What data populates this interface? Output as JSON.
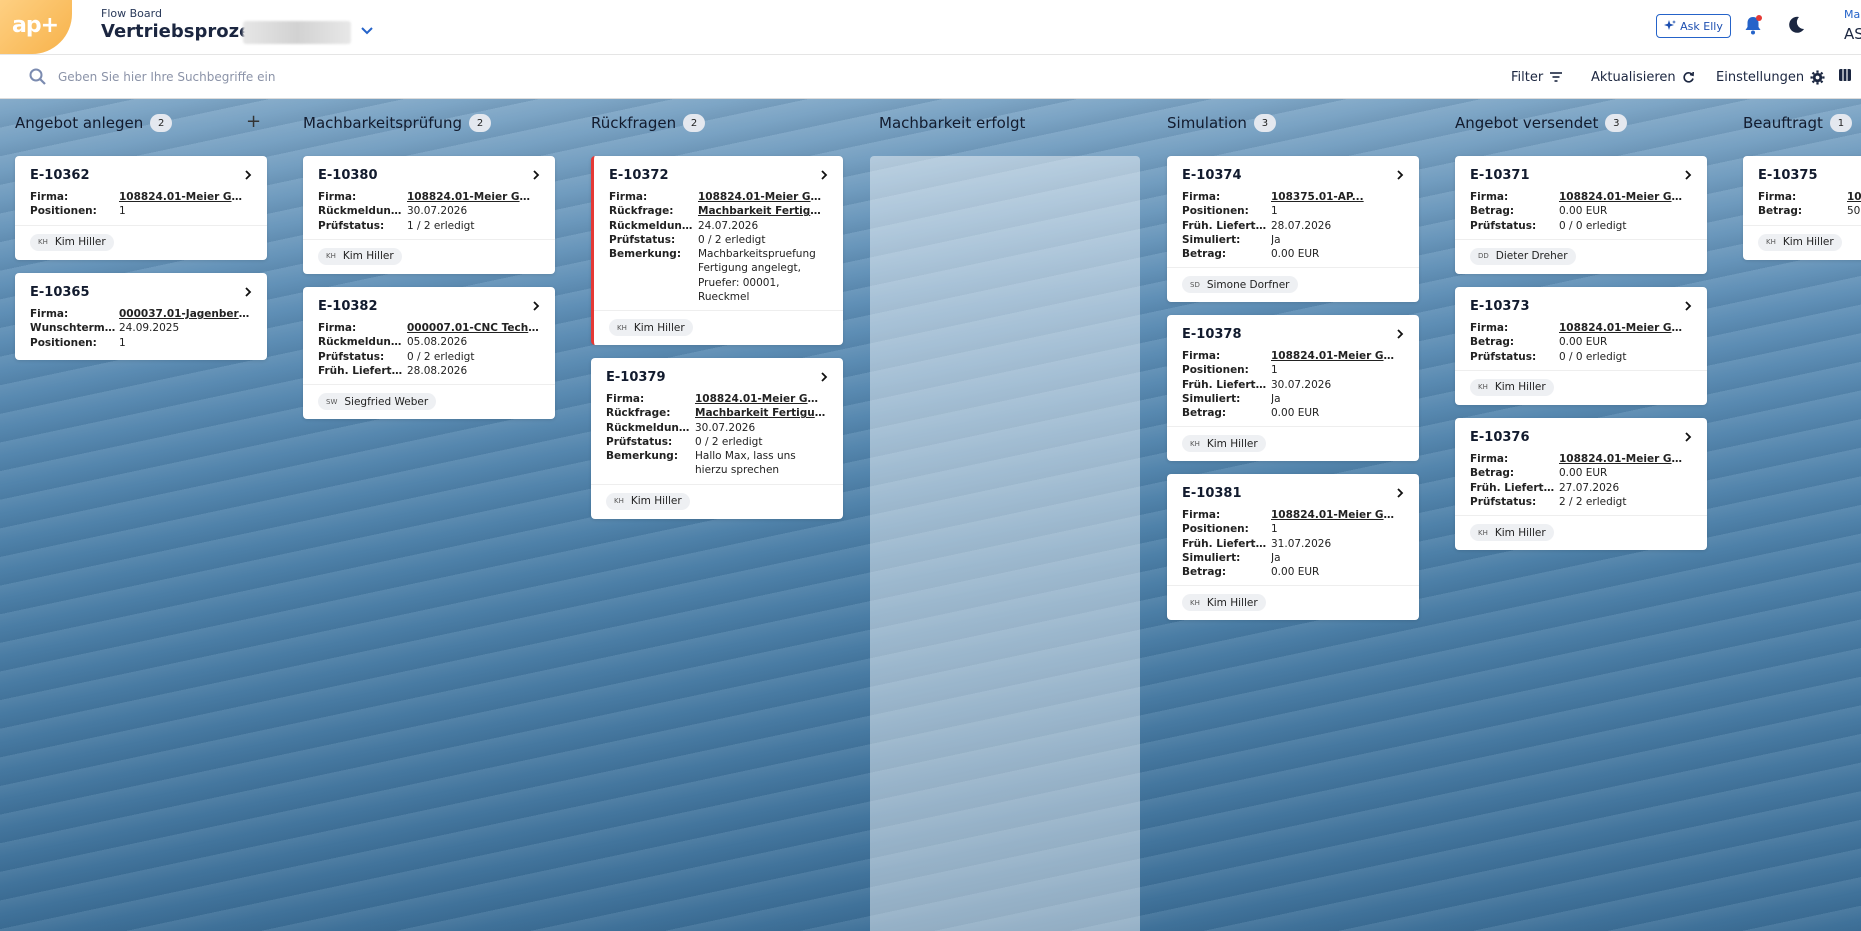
{
  "header": {
    "logo_text": "ap+",
    "subtitle": "Flow Board",
    "title": "Vertriebsprozess",
    "ask_label": "Ask Elly",
    "user_line1": "Ma",
    "user_line2": "AS"
  },
  "toolbar": {
    "search_placeholder": "Geben Sie hier Ihre Suchbegriffe ein",
    "filter_label": "Filter",
    "refresh_label": "Aktualisieren",
    "settings_label": "Einstellungen"
  },
  "columns": [
    {
      "title": "Angebot anlegen",
      "count": "2",
      "cards": [
        {
          "id": "E-10362",
          "rows": [
            [
              "Firma:",
              "108824.01-Meier GmbH"
            ],
            [
              "Positionen:",
              "1"
            ]
          ],
          "assignee_initials": "KH",
          "assignee": "Kim Hiller"
        },
        {
          "id": "E-10365",
          "rows": [
            [
              "Firma:",
              "000037.01-Jagenberg A..."
            ],
            [
              "Wunschtermin:",
              "24.09.2025"
            ],
            [
              "Positionen:",
              "1"
            ]
          ],
          "assignee_initials": "",
          "assignee": ""
        }
      ]
    },
    {
      "title": "Machbarkeitsprüfung",
      "count": "2",
      "cards": [
        {
          "id": "E-10380",
          "rows": [
            [
              "Firma:",
              "108824.01-Meier GmbH"
            ],
            [
              "Rückmeldung b...",
              "30.07.2026"
            ],
            [
              "Prüfstatus:",
              "1 / 2 erledigt"
            ]
          ],
          "assignee_initials": "KH",
          "assignee": "Kim Hiller"
        },
        {
          "id": "E-10382",
          "rows": [
            [
              "Firma:",
              "000007.01-CNC Technik"
            ],
            [
              "Rückmeldung b...",
              "05.08.2026"
            ],
            [
              "Prüfstatus:",
              "0 / 2 erledigt"
            ],
            [
              "Früh. Lieferter...",
              "28.08.2026"
            ]
          ],
          "assignee_initials": "SW",
          "assignee": "Siegfried Weber"
        }
      ]
    },
    {
      "title": "Rückfragen",
      "count": "2",
      "cards": [
        {
          "id": "E-10372",
          "rows": [
            [
              "Firma:",
              "108824.01-Meier GmbH"
            ],
            [
              "Rückfrage:",
              "Machbarkeit Fertigung: ..."
            ],
            [
              "Rückmeldung b...",
              "24.07.2026"
            ],
            [
              "Prüfstatus:",
              "0 / 2 erledigt"
            ],
            [
              "Bemerkung:",
              "Machbarkeitspruefung Fertigung angelegt, Pruefer: 00001, Rueckmel"
            ]
          ],
          "assignee_initials": "KH",
          "assignee": "Kim Hiller"
        },
        {
          "id": "E-10379",
          "rows": [
            [
              "Firma:",
              "108824.01-Meier GmbH"
            ],
            [
              "Rückfrage:",
              "Machbarkeit Fertigung: ..."
            ],
            [
              "Rückmeldung b...",
              "30.07.2026"
            ],
            [
              "Prüfstatus:",
              "0 / 2 erledigt"
            ],
            [
              "Bemerkung:",
              "Hallo Max, lass uns hierzu sprechen"
            ]
          ],
          "assignee_initials": "KH",
          "assignee": "Kim Hiller"
        }
      ]
    },
    {
      "title": "Machbarkeit erfolgt",
      "count": "",
      "cards": []
    },
    {
      "title": "Simulation",
      "count": "3",
      "cards": [
        {
          "id": "E-10374",
          "rows": [
            [
              "Firma:",
              "108375.01-AP..."
            ],
            [
              "Positionen:",
              "1"
            ],
            [
              "Früh. Lieferter...",
              "28.07.2026"
            ],
            [
              "Simuliert:",
              "Ja"
            ],
            [
              "Betrag:",
              "0.00 EUR"
            ]
          ],
          "assignee_initials": "SD",
          "assignee": "Simone Dorfner"
        },
        {
          "id": "E-10378",
          "rows": [
            [
              "Firma:",
              "108824.01-Meier GmbH"
            ],
            [
              "Positionen:",
              "1"
            ],
            [
              "Früh. Lieferter...",
              "30.07.2026"
            ],
            [
              "Simuliert:",
              "Ja"
            ],
            [
              "Betrag:",
              "0.00 EUR"
            ]
          ],
          "assignee_initials": "KH",
          "assignee": "Kim Hiller"
        },
        {
          "id": "E-10381",
          "rows": [
            [
              "Firma:",
              "108824.01-Meier GmbH"
            ],
            [
              "Positionen:",
              "1"
            ],
            [
              "Früh. Lieferter...",
              "31.07.2026"
            ],
            [
              "Simuliert:",
              "Ja"
            ],
            [
              "Betrag:",
              "0.00 EUR"
            ]
          ],
          "assignee_initials": "KH",
          "assignee": "Kim Hiller"
        }
      ]
    },
    {
      "title": "Angebot versendet",
      "count": "3",
      "cards": [
        {
          "id": "E-10371",
          "rows": [
            [
              "Firma:",
              "108824.01-Meier GmbH"
            ],
            [
              "Betrag:",
              "0.00 EUR"
            ],
            [
              "Prüfstatus:",
              "0 / 0 erledigt"
            ]
          ],
          "assignee_initials": "DD",
          "assignee": "Dieter Dreher"
        },
        {
          "id": "E-10373",
          "rows": [
            [
              "Firma:",
              "108824.01-Meier GmbH"
            ],
            [
              "Betrag:",
              "0.00 EUR"
            ],
            [
              "Prüfstatus:",
              "0 / 0 erledigt"
            ]
          ],
          "assignee_initials": "KH",
          "assignee": "Kim Hiller"
        },
        {
          "id": "E-10376",
          "rows": [
            [
              "Firma:",
              "108824.01-Meier GmbH"
            ],
            [
              "Betrag:",
              "0.00 EUR"
            ],
            [
              "Früh. Lieferter...",
              "27.07.2026"
            ],
            [
              "Prüfstatus:",
              "2 / 2 erledigt"
            ]
          ],
          "assignee_initials": "KH",
          "assignee": "Kim Hiller"
        }
      ]
    },
    {
      "title": "Beauftragt",
      "count": "1",
      "cards": [
        {
          "id": "E-10375",
          "rows": [
            [
              "Firma:",
              "10"
            ],
            [
              "Betrag:",
              "50"
            ]
          ],
          "assignee_initials": "KH",
          "assignee": "Kim Hiller"
        }
      ]
    }
  ],
  "colors": {
    "accent": "#2563c9",
    "flag": "#e53935",
    "logo": "#f7b24a"
  }
}
